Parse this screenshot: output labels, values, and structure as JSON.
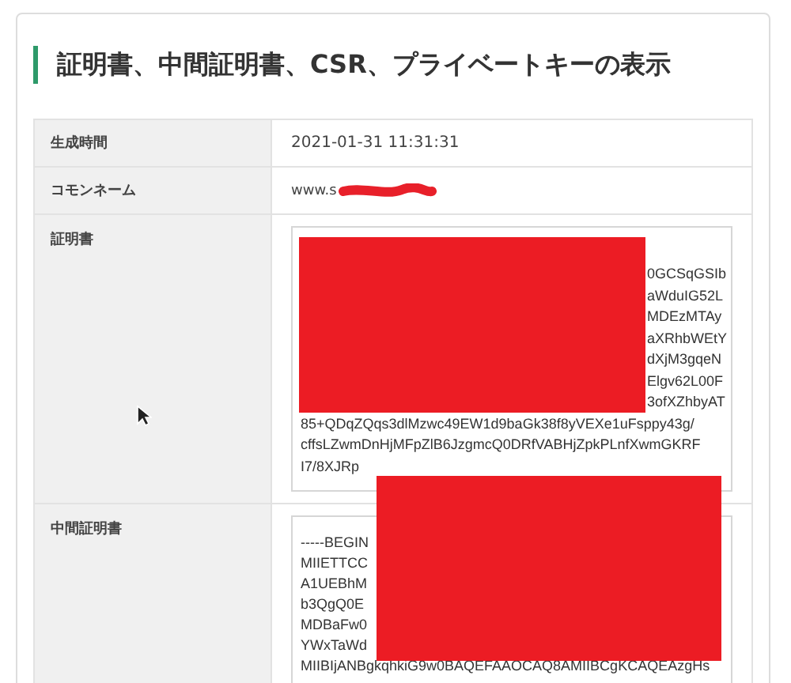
{
  "heading": "証明書、中間証明書、CSR、プライベートキーの表示",
  "rows": [
    {
      "label": "生成時間",
      "kind": "text",
      "value": "2021-01-31 11:31:31"
    },
    {
      "label": "コモンネーム",
      "kind": "redacted_text",
      "value": "www.s"
    },
    {
      "label": "証明書",
      "kind": "textarea",
      "right_fragments": [
        "0GCSqGSIb",
        "aWduIG52L",
        "MDEzMTAy",
        "aXRhbWEtY",
        "dXjM3gqeN",
        "Elgv62L00F",
        "3ofXZhbyAT"
      ],
      "lines": [
        "85+QDqZQqs3dlMzwc49EW1d9baGk38f8yVEXe1uFsppy43g/",
        "cffsLZwmDnHjMFpZlB6JzgmcQ0DRfVABHjZpkPLnfXwmGKRF",
        "I7/8XJRp"
      ]
    },
    {
      "label": "中間証明書",
      "kind": "textarea",
      "left_fragments": [
        "-----BEGIN",
        "MIIETTCC",
        "A1UEBhM",
        "b3QgQ0E",
        "MDBaFw0",
        "YWxTaWd"
      ],
      "lines": [
        "MIIBIjANBgkqhkiG9w0BAQEFAAOCAQ8AMIIBCgKCAQEAzgHs"
      ]
    }
  ]
}
